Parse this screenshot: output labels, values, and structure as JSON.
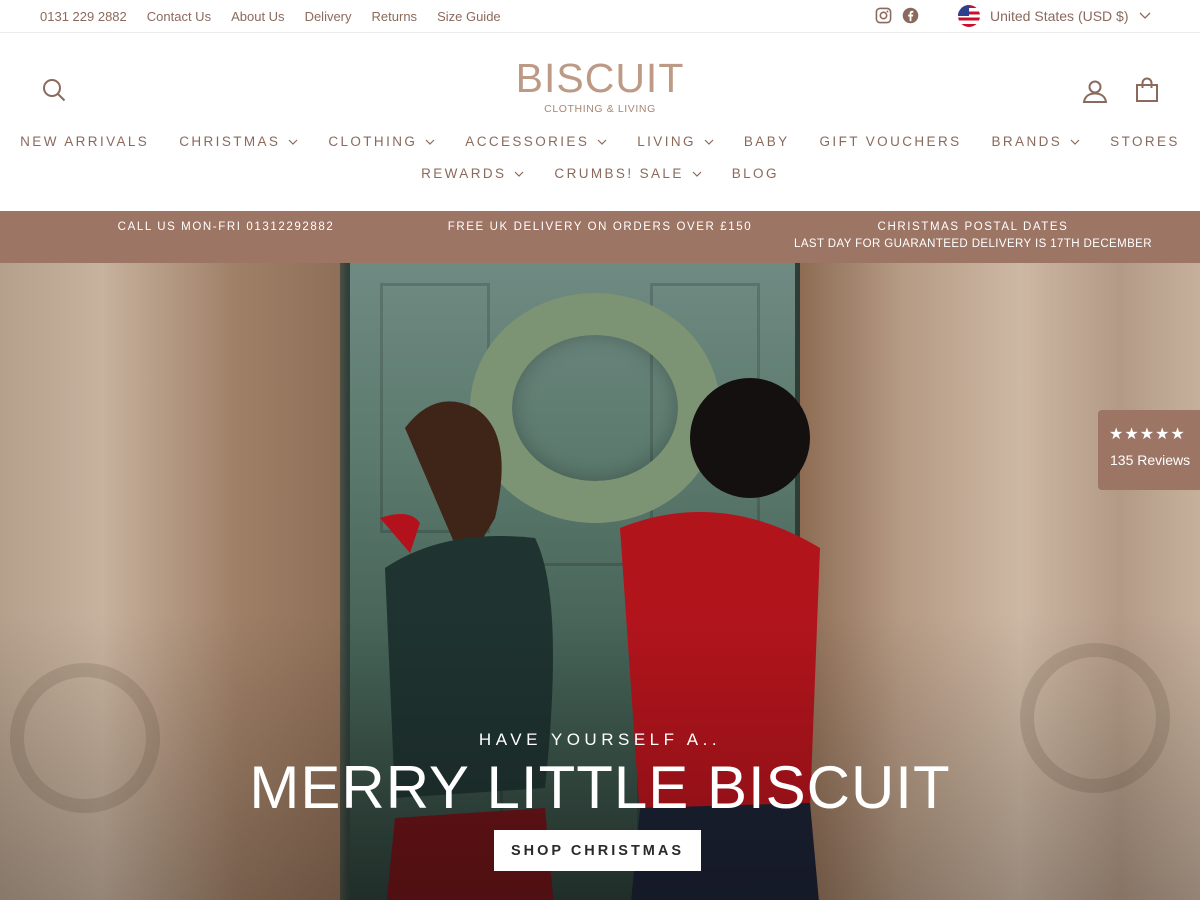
{
  "utility": {
    "links": [
      "0131 229 2882",
      "Contact Us",
      "About Us",
      "Delivery",
      "Returns",
      "Size Guide"
    ],
    "social_icons": [
      "instagram-icon",
      "facebook-icon"
    ],
    "currency": "United States (USD $)"
  },
  "header": {
    "logo_word": "BISCUIT",
    "logo_sub": "CLOTHING & LIVING",
    "icons": [
      "search-icon",
      "account-icon",
      "cart-icon"
    ]
  },
  "nav": {
    "row1": [
      {
        "label": "NEW ARRIVALS",
        "dropdown": false
      },
      {
        "label": "CHRISTMAS",
        "dropdown": true
      },
      {
        "label": "CLOTHING",
        "dropdown": true
      },
      {
        "label": "ACCESSORIES",
        "dropdown": true
      },
      {
        "label": "LIVING",
        "dropdown": true
      },
      {
        "label": "BABY",
        "dropdown": false
      },
      {
        "label": "GIFT VOUCHERS",
        "dropdown": false
      },
      {
        "label": "BRANDS",
        "dropdown": true
      },
      {
        "label": "STORES",
        "dropdown": false
      }
    ],
    "row2": [
      {
        "label": "REWARDS",
        "dropdown": true
      },
      {
        "label": "CRUMBS! SALE",
        "dropdown": true
      },
      {
        "label": "BLOG",
        "dropdown": false
      }
    ]
  },
  "announcement": {
    "phone": "CALL US MON-FRI 01312292882",
    "delivery": "FREE UK DELIVERY ON ORDERS OVER £150",
    "postal_title": "CHRISTMAS POSTAL DATES",
    "postal_detail": "LAST DAY FOR GUARANTEED DELIVERY IS 17TH DECEMBER"
  },
  "hero": {
    "eyebrow": "HAVE YOURSELF A..",
    "headline": "MERRY LITTLE BISCUIT",
    "cta": "SHOP CHRISTMAS"
  },
  "reviews": {
    "stars": "★★★★★",
    "rating": 4.5,
    "count": "135 Reviews"
  },
  "colors": {
    "brand": "#9d7565",
    "text": "#8b6a5c",
    "logo": "#bc9a86"
  }
}
